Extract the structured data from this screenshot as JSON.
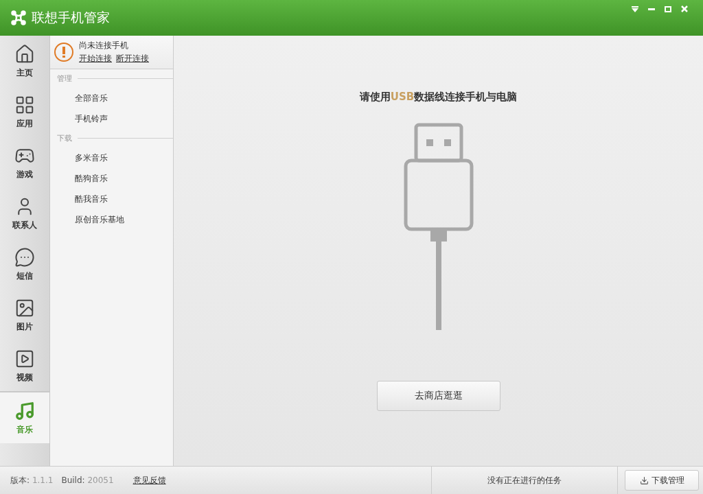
{
  "window": {
    "title": "联想手机管家"
  },
  "nav": [
    {
      "label": "主页",
      "selected": false
    },
    {
      "label": "应用",
      "selected": false
    },
    {
      "label": "游戏",
      "selected": false
    },
    {
      "label": "联系人",
      "selected": false
    },
    {
      "label": "短信",
      "selected": false
    },
    {
      "label": "图片",
      "selected": false
    },
    {
      "label": "视频",
      "selected": false
    },
    {
      "label": "音乐",
      "selected": true
    }
  ],
  "connection": {
    "status": "尚未连接手机",
    "links": [
      "开始连接",
      "断开连接"
    ]
  },
  "sections": [
    {
      "title": "管理",
      "items": [
        "全部音乐",
        "手机铃声"
      ]
    },
    {
      "title": "下载",
      "items": [
        "多米音乐",
        "酷狗音乐",
        "酷我音乐",
        "原创音乐基地"
      ]
    }
  ],
  "main": {
    "prompt": "请使用**USB**数据线连接手机与电脑",
    "button": "去商店逛逛"
  },
  "status_bar": {
    "version_label": "版本:",
    "version": "1.1.1",
    "build_label": "Build:",
    "build": "20051",
    "feedback": "意见反馈",
    "tasks": "没有正在进行的任务",
    "download_button": "下载管理"
  }
}
